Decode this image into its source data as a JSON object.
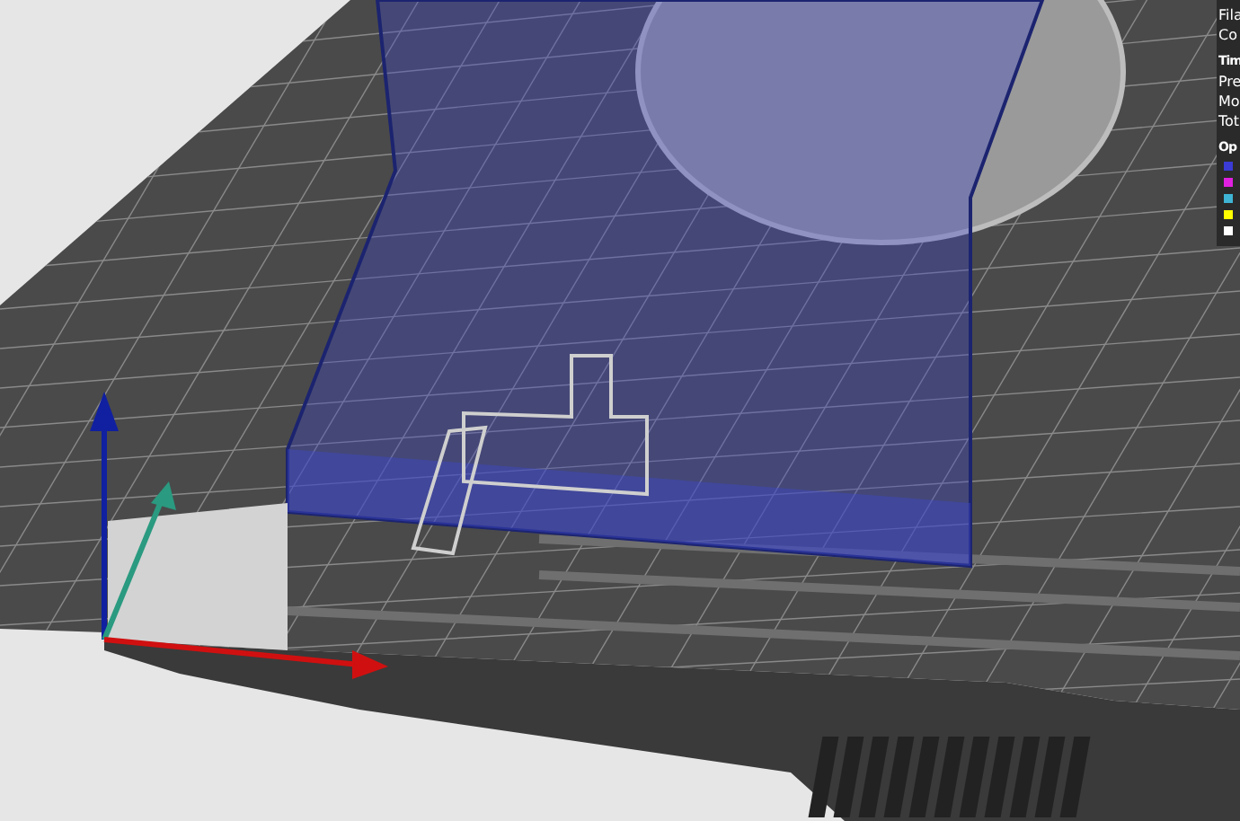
{
  "legend": {
    "header_lines": [
      "Fila",
      "Co"
    ],
    "sections": [
      {
        "title": "Tim",
        "lines": [
          "Pre",
          "Mo",
          "Tot"
        ]
      },
      {
        "title": "Op"
      }
    ],
    "items": [
      {
        "color": "#3b3bd6"
      },
      {
        "color": "#e020e0"
      },
      {
        "color": "#3fb4d4"
      },
      {
        "color": "#ffff00"
      },
      {
        "color": "#ffffff"
      }
    ]
  }
}
